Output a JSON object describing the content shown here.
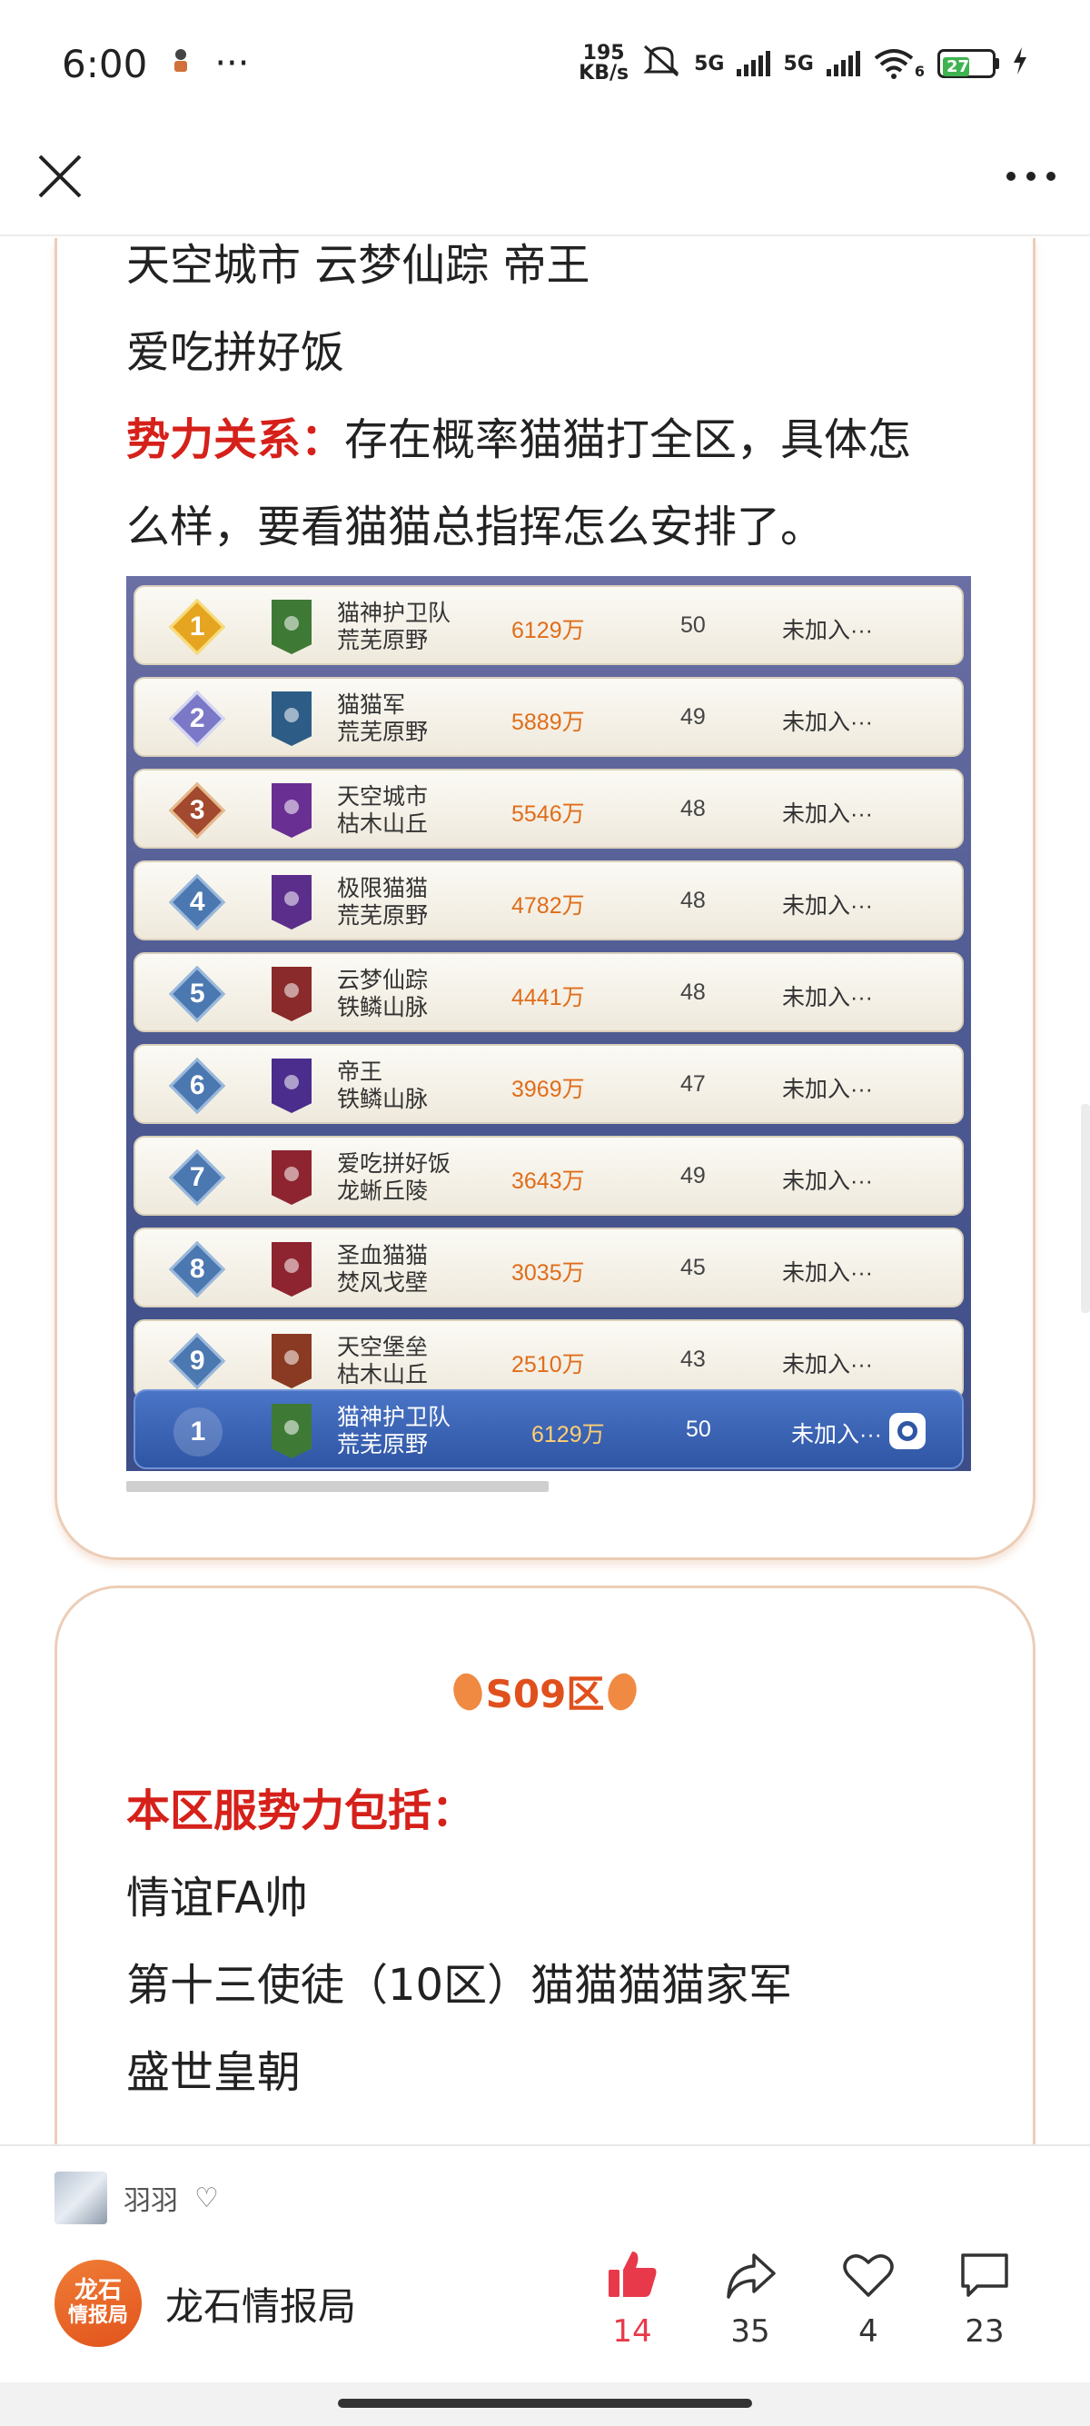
{
  "status_bar": {
    "time": "6:00",
    "more": "···",
    "net_speed_value": "195",
    "net_speed_unit": "KB/s",
    "sim1": "5G",
    "sim2": "5G",
    "wifi": "6",
    "battery": "27"
  },
  "card1": {
    "lines": [
      "天空城市  云梦仙踪 帝王",
      "爱吃拼好饭"
    ],
    "relation_label": "势力关系：",
    "relation_text_1": "存在概率猫猫打全区，具体怎",
    "relation_text_2": "么样，要看猫猫总指挥怎么安排了。",
    "leaderboard": [
      {
        "rank": "1",
        "name": "猫神护卫队",
        "region": "荒芜原野",
        "power": "6129万",
        "level": "50",
        "status": "未加入···",
        "banner": "#3e7a36"
      },
      {
        "rank": "2",
        "name": "猫猫军",
        "region": "荒芜原野",
        "power": "5889万",
        "level": "49",
        "status": "未加入···",
        "banner": "#2d5d86"
      },
      {
        "rank": "3",
        "name": "天空城市",
        "region": "枯木山丘",
        "power": "5546万",
        "level": "48",
        "status": "未加入···",
        "banner": "#6a2f93"
      },
      {
        "rank": "4",
        "name": "极限猫猫",
        "region": "荒芜原野",
        "power": "4782万",
        "level": "48",
        "status": "未加入···",
        "banner": "#5b2e8c"
      },
      {
        "rank": "5",
        "name": "云梦仙踪",
        "region": "铁鳞山脉",
        "power": "4441万",
        "level": "48",
        "status": "未加入···",
        "banner": "#8a2a2a"
      },
      {
        "rank": "6",
        "name": "帝王",
        "region": "铁鳞山脉",
        "power": "3969万",
        "level": "47",
        "status": "未加入···",
        "banner": "#4a2d8c"
      },
      {
        "rank": "7",
        "name": "爱吃拼好饭",
        "region": "龙蜥丘陵",
        "power": "3643万",
        "level": "49",
        "status": "未加入···",
        "banner": "#8e2430"
      },
      {
        "rank": "8",
        "name": "圣血猫猫",
        "region": "焚风戈壁",
        "power": "3035万",
        "level": "45",
        "status": "未加入···",
        "banner": "#8e2430"
      },
      {
        "rank": "9",
        "name": "天空堡垒",
        "region": "枯木山丘",
        "power": "2510万",
        "level": "43",
        "status": "未加入···",
        "banner": "#8a3a22"
      }
    ],
    "my_row": {
      "rank": "1",
      "name": "猫神护卫队",
      "region": "荒芜原野",
      "power": "6129万",
      "level": "50",
      "status": "未加入···"
    }
  },
  "card2": {
    "title": "S09区",
    "forces_label": "本区服势力包括：",
    "forces": [
      "情谊FA帅",
      "第十三使徒（10区）猫猫猫猫家军",
      "盛世皇朝"
    ]
  },
  "bottom_bar": {
    "author": "羽羽",
    "account_name": "龙石情报局",
    "logo_line1": "龙石",
    "logo_line2": "情报局",
    "likes": "14",
    "shares": "35",
    "favorites": "4",
    "comments": "23",
    "like_color": "#e8394b"
  }
}
